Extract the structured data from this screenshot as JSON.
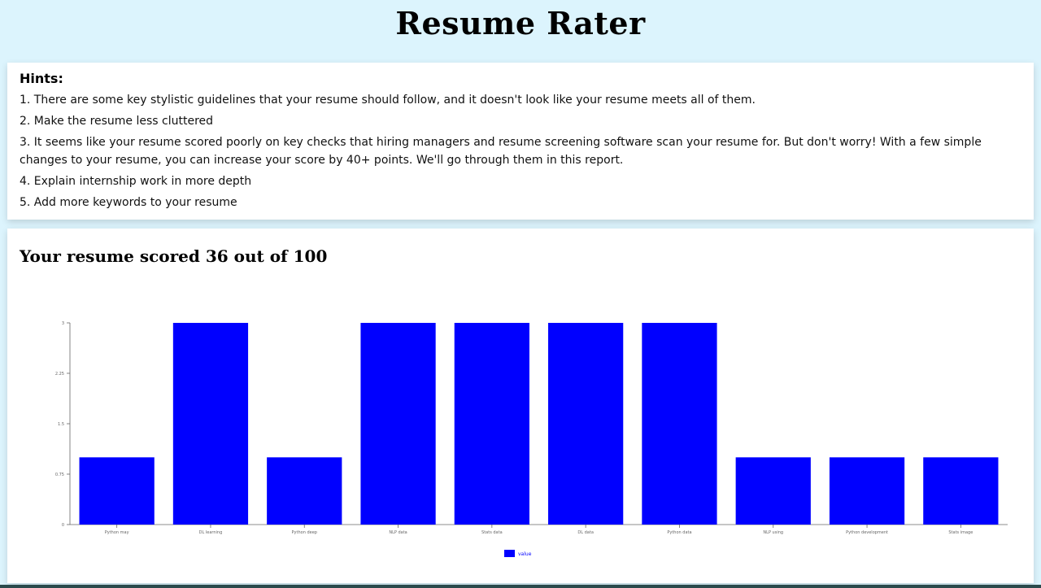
{
  "app": {
    "title": "Resume Rater"
  },
  "hints": {
    "title": "Hints:",
    "items": [
      "1. There are some key stylistic guidelines that your resume should follow, and it doesn't look like your resume meets all of them.",
      "2. Make the resume less cluttered",
      "3. It seems like your resume scored poorly on key checks that hiring managers and resume screening software scan your resume for. But don't worry! With a few simple changes to your resume, you can increase your score by 40+ points. We'll go through them in this report.",
      "4. Explain internship work in more depth",
      "5. Add more keywords to your resume"
    ]
  },
  "score": {
    "prefix": "Your resume scored ",
    "value": "36",
    "middle": " out of ",
    "max": "100"
  },
  "chart_data": {
    "type": "bar",
    "categories": [
      "Python may",
      "DL learning",
      "Python deep",
      "NLP data",
      "Stats data",
      "DL data",
      "Python data",
      "NLP using",
      "Python development",
      "Stats image"
    ],
    "series": [
      {
        "name": "value",
        "values": [
          1,
          3,
          1,
          3,
          3,
          3,
          3,
          1,
          1,
          1
        ],
        "color": "#0000ff"
      }
    ],
    "yticks": [
      "0",
      "0.75",
      "1.5",
      "2.25",
      "3"
    ],
    "ylim": [
      0,
      3
    ],
    "grid": false,
    "legend": "bottom-center"
  }
}
